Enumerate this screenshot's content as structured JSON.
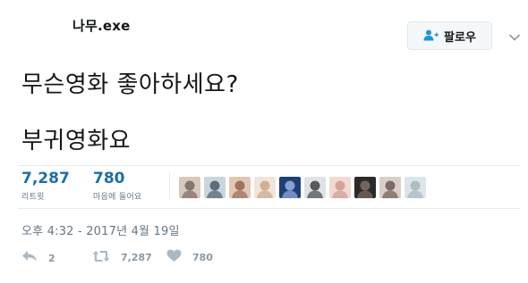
{
  "header": {
    "user_name": "나무.exe",
    "follow_label": "팔로우"
  },
  "tweet": {
    "line1": "무슨영화 좋아하세요?",
    "line2": "부귀영화요"
  },
  "stats": {
    "retweets": {
      "count": "7,287",
      "label": "리트윗"
    },
    "likes": {
      "count": "780",
      "label": "마음에 들어요"
    }
  },
  "likers": {
    "avatars": [
      {
        "name": "liker-avatar-1",
        "colors": [
          "#d8c9bd",
          "#6b5a52"
        ]
      },
      {
        "name": "liker-avatar-2",
        "colors": [
          "#c9d6df",
          "#3b4a5a"
        ]
      },
      {
        "name": "liker-avatar-3",
        "colors": [
          "#e3c7b5",
          "#8a5a44"
        ]
      },
      {
        "name": "liker-avatar-4",
        "colors": [
          "#eee6da",
          "#c79c7b"
        ]
      },
      {
        "name": "liker-avatar-5",
        "colors": [
          "#1f3f7a",
          "#a8c3e8"
        ]
      },
      {
        "name": "liker-avatar-6",
        "colors": [
          "#dfe3e6",
          "#2b2d30"
        ]
      },
      {
        "name": "liker-avatar-7",
        "colors": [
          "#f2d9d3",
          "#c9908a"
        ]
      },
      {
        "name": "liker-avatar-8",
        "colors": [
          "#2a2a2a",
          "#8d7a72"
        ]
      },
      {
        "name": "liker-avatar-9",
        "colors": [
          "#d9cfc6",
          "#5e4a42"
        ]
      },
      {
        "name": "liker-avatar-10",
        "colors": [
          "#dce6ea",
          "#9cb2b8"
        ]
      }
    ]
  },
  "timestamp": "오후 4:32 - 2017년 4월 19일",
  "actions": {
    "reply_count": "2",
    "retweet_count": "7,287",
    "like_count": "780"
  },
  "colors": {
    "text": "#14171a",
    "muted": "#657786",
    "accent": "#1b6fa8",
    "icon": "#aab8c2",
    "border": "#e6ecf0"
  },
  "icons": {
    "follow": "person-plus-icon",
    "caret": "chevron-down-icon",
    "reply": "reply-icon",
    "retweet": "retweet-icon",
    "like": "heart-icon"
  }
}
